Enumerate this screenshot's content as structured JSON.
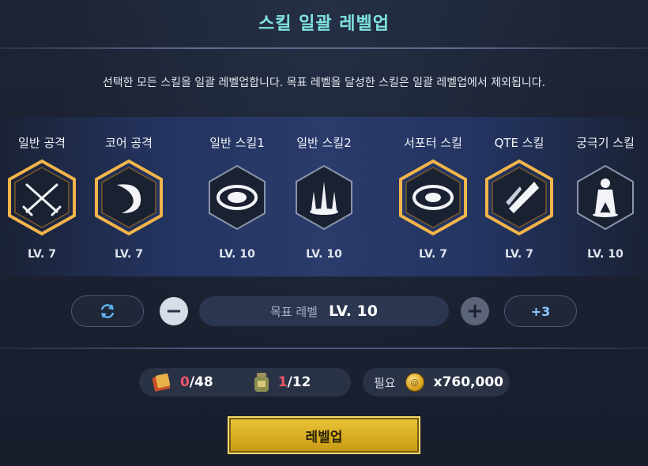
{
  "title": "스킬 일괄 레벨업",
  "description": "선택한 모든 스킬을 일괄 레벨업합니다. 목표 레벨을 달성한 스킬은 일괄 레벨업에서 제외됩니다.",
  "skills": [
    {
      "name": "일반 공격",
      "level": "LV. 7",
      "selected": true,
      "icon": "crossed-swords-icon"
    },
    {
      "name": "코어 공격",
      "level": "LV. 7",
      "selected": true,
      "icon": "slash-arc-icon"
    },
    {
      "name": "일반 스킬1",
      "level": "LV. 10",
      "selected": false,
      "icon": "vortex-icon"
    },
    {
      "name": "일반 스킬2",
      "level": "LV. 10",
      "selected": false,
      "icon": "spike-burst-icon"
    },
    {
      "name": "서포터 스킬",
      "level": "LV. 7",
      "selected": true,
      "icon": "swirl-icon"
    },
    {
      "name": "QTE 스킬",
      "level": "LV. 7",
      "selected": true,
      "icon": "blade-strike-icon"
    },
    {
      "name": "궁극기 스킬",
      "level": "LV. 10",
      "selected": false,
      "icon": "silhouette-icon"
    }
  ],
  "controls": {
    "reset_icon": "refresh-icon",
    "minus_label": "−",
    "target_label": "목표 레벨",
    "target_value": "LV. 10",
    "plus_label": "+",
    "increment_label": "+3"
  },
  "resources": {
    "material1": {
      "have": "0",
      "need": "/48",
      "icon": "book-material-icon"
    },
    "material2": {
      "have": "1",
      "need": "/12",
      "icon": "jar-material-icon"
    },
    "cost_label": "필요",
    "cost_value": "x760,000",
    "coin_icon": "gold-coin-icon"
  },
  "levelup_button": "레벨업",
  "colors": {
    "title": "#7fe3e0",
    "selected_frame": "#e6a23c",
    "button": "#d8ad22",
    "deficit": "#f0566a"
  }
}
